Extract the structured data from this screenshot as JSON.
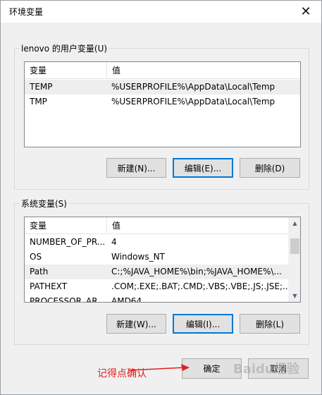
{
  "window": {
    "title": "环境变量",
    "close_icon": "✕"
  },
  "user_vars": {
    "group_label": "lenovo 的用户变量(U)",
    "columns": [
      "变量",
      "值"
    ],
    "rows": [
      {
        "name": "TEMP",
        "value": "%USERPROFILE%\\AppData\\Local\\Temp"
      },
      {
        "name": "TMP",
        "value": "%USERPROFILE%\\AppData\\Local\\Temp"
      }
    ],
    "buttons": {
      "new": "新建(N)...",
      "edit": "编辑(E)...",
      "delete": "删除(D)"
    }
  },
  "system_vars": {
    "group_label": "系统变量(S)",
    "columns": [
      "变量",
      "值"
    ],
    "rows": [
      {
        "name": "NUMBER_OF_PR...",
        "value": "4"
      },
      {
        "name": "OS",
        "value": "Windows_NT"
      },
      {
        "name": "Path",
        "value": "C:;%JAVA_HOME%\\bin;%JAVA_HOME%\\..."
      },
      {
        "name": "PATHEXT",
        "value": ".COM;.EXE;.BAT;.CMD;.VBS;.VBE;.JS;.JSE;..."
      },
      {
        "name": "PROCESSOR_AR...",
        "value": "AMD64"
      }
    ],
    "buttons": {
      "new": "新建(W)...",
      "edit": "编辑(I)...",
      "delete": "删除(L)"
    }
  },
  "footer": {
    "ok": "确定",
    "cancel": "取消"
  },
  "annotation": {
    "text": "记得点确认",
    "color": "#e02020"
  },
  "watermark": {
    "text": "Baidu经验"
  }
}
